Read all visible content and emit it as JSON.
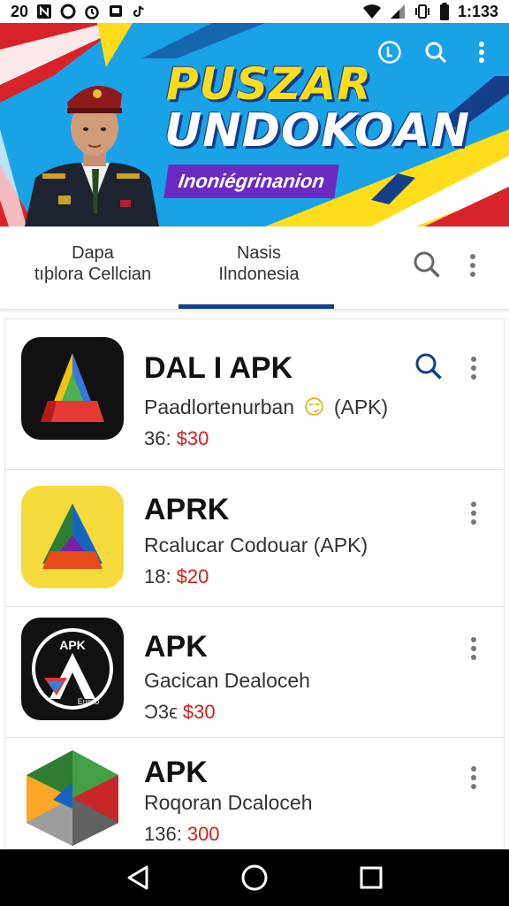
{
  "status_bar": {
    "time_left": "20",
    "time_right": "1:133",
    "left_icons": [
      "notification-n-icon",
      "circle-notification-icon",
      "alarm-icon",
      "message-icon",
      "tiktok-icon"
    ],
    "right_icons": [
      "wifi-icon",
      "signal-icon",
      "vibrate-icon",
      "battery-icon"
    ]
  },
  "banner": {
    "title_line1": "PUSZAR",
    "title_line2": "UNDOKOAN",
    "subtitle": "Inoniégrinanion",
    "icons": [
      "info-icon",
      "search-icon",
      "more-vert-icon"
    ]
  },
  "tabs": [
    {
      "line1": "Dapa",
      "line2": "tıþlora Cellcian"
    },
    {
      "line1": "Nasis",
      "line2": "Ilndonesia"
    }
  ],
  "apps": [
    {
      "name": "DAL I APK",
      "desc": "Paadlortenurban",
      "desc_suffix": "(APK)",
      "emoji": "😏",
      "meta": "36:",
      "price": "$30",
      "has_search": true
    },
    {
      "name": "APRK",
      "desc": "Rcalucar Codouar (APK)",
      "meta": "18:",
      "price": "$20",
      "has_search": false
    },
    {
      "name": "APK",
      "desc": "Gacican Dealoceh",
      "meta": "Ͻ3ϵ",
      "price": "$30",
      "has_search": false,
      "icon_label": "APK",
      "icon_small": "Eusiio"
    },
    {
      "name": "APK",
      "desc": "Roqoran Dcaloceh",
      "meta": "136:",
      "price": "300",
      "has_search": false
    }
  ],
  "colors": {
    "price": "#d0201c",
    "tab_indicator": "#123e8c",
    "banner_blue": "#1aa2e6",
    "banner_yellow": "#ffdd1a",
    "banner_purple": "#6a2bc2"
  }
}
